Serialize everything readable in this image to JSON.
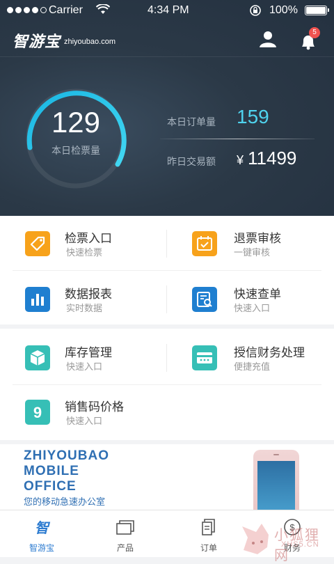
{
  "status_bar": {
    "carrier": "Carrier",
    "time": "4:34 PM",
    "battery": "100%"
  },
  "header": {
    "logo": "智游宝",
    "domain": "zhiyoubao.com",
    "notification_count": "5"
  },
  "dashboard": {
    "checked_tickets": {
      "value": "129",
      "label": "本日检票量"
    },
    "orders_today": {
      "label": "本日订单量",
      "value": "159"
    },
    "yesterday_amount": {
      "label": "昨日交易额",
      "currency": "¥",
      "value": "11499"
    }
  },
  "menu": [
    {
      "title": "检票入口",
      "subtitle": "快速检票",
      "icon": "tag-icon",
      "color": "#f7a21b"
    },
    {
      "title": "退票审核",
      "subtitle": "一键审核",
      "icon": "calendar-check-icon",
      "color": "#f7a21b"
    },
    {
      "title": "数据报表",
      "subtitle": "实时数据",
      "icon": "bar-chart-icon",
      "color": "#1f7fd0"
    },
    {
      "title": "快速查单",
      "subtitle": "快速入口",
      "icon": "search-document-icon",
      "color": "#1f7fd0"
    },
    {
      "title": "库存管理",
      "subtitle": "快速入口",
      "icon": "box-icon",
      "color": "#36bfb6"
    },
    {
      "title": "授信财务处理",
      "subtitle": "便捷充值",
      "icon": "card-icon",
      "color": "#36bfb6"
    },
    {
      "title": "销售码价格",
      "subtitle": "快速入口",
      "icon": "nine-icon",
      "color": "#36bfb6"
    }
  ],
  "banner": {
    "line1": "ZHIYOUBAO",
    "line2": "MOBILE",
    "line3": "OFFICE",
    "subtitle": "您的移动急速办公室"
  },
  "tabs": [
    {
      "label": "智游宝",
      "icon": "home-logo-icon",
      "active": true
    },
    {
      "label": "产品",
      "icon": "cards-icon",
      "active": false
    },
    {
      "label": "订单",
      "icon": "copy-icon",
      "active": false
    },
    {
      "label": "财务",
      "icon": "dollar-icon",
      "active": false
    }
  ],
  "watermark": {
    "text": "小狐狸网",
    "sub": "XHS5.CN"
  },
  "colors": {
    "accent": "#4fd3ee",
    "header_bg": "#2b3947",
    "tab_active": "#2c7bd0",
    "badge": "#f0524f"
  }
}
